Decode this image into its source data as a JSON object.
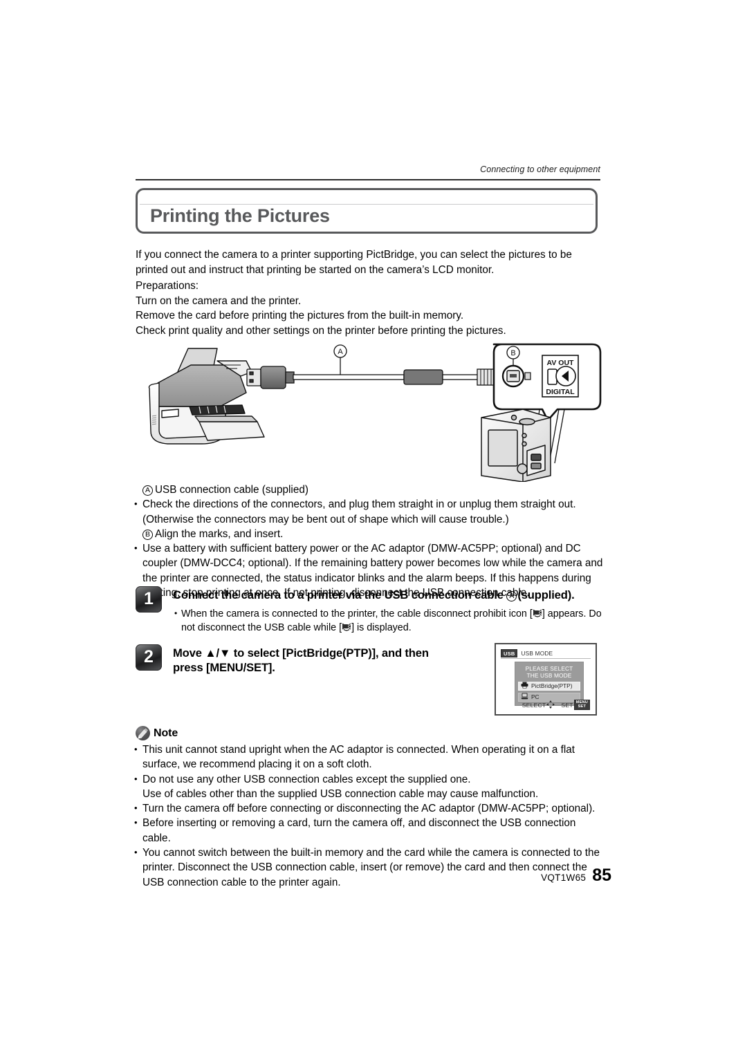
{
  "header": {
    "running_head": "Connecting to other equipment"
  },
  "title": {
    "text": "Printing the Pictures"
  },
  "intro": {
    "paragraph": "If you connect the camera to a printer supporting PictBridge, you can select the pictures to be printed out and instruct that printing be started on the camera’s LCD monitor."
  },
  "preparations": {
    "lines": [
      "Preparations:",
      "Turn on the camera and the printer.",
      "Remove the card before printing the pictures from the built-in memory.",
      "Check print quality and other settings on the printer before printing the pictures."
    ]
  },
  "diagram": {
    "label_a": "A",
    "label_b": "B",
    "camera_port_av": "AV OUT",
    "camera_port_digital": "DIGITAL"
  },
  "after_diagram": {
    "items": [
      {
        "marker": "A",
        "text": "USB connection cable (supplied)"
      },
      {
        "marker": "bullet",
        "text": "Check the directions of the connectors, and plug them straight in or unplug them straight out. (Otherwise the connectors may be bent out of shape which will cause trouble.)"
      },
      {
        "marker": "B",
        "text": "Align the marks, and insert."
      },
      {
        "marker": "bullet",
        "text": "Use a battery with sufficient battery power or the AC adaptor (DMW-AC5PP; optional) and DC coupler (DMW-DCC4; optional). If the remaining battery power becomes low while the camera and the printer are connected, the status indicator blinks and the alarm beeps. If this happens during printing, stop printing at once. If not printing, disconnect the USB connection cable."
      }
    ]
  },
  "steps": [
    {
      "number": "1",
      "title_before": "Connect the camera to a printer via the USB connection cable",
      "title_ref": "A",
      "title_after": "(supplied).",
      "sub_before": "When the camera is connected to the printer, the cable disconnect prohibit icon [",
      "sub_middle": "] appears. Do not disconnect the USB cable while [",
      "sub_after": "] is displayed."
    },
    {
      "number": "2",
      "title_line1": "Move ▲/▼ to select [PictBridge(PTP)], and then",
      "title_line2": "press [MENU/SET]."
    }
  ],
  "lcd": {
    "usb_tag": "USB",
    "topbar_label": "USB MODE",
    "panel_title_line1": "PLEASE SELECT",
    "panel_title_line2": "THE USB MODE",
    "options": [
      {
        "label": "PictBridge(PTP)",
        "selected": true,
        "icon": "printer-icon"
      },
      {
        "label": "PC",
        "selected": false,
        "icon": "pc-icon"
      }
    ],
    "footer_select": "SELECT",
    "footer_set": "SET",
    "set_key_line1": "MENU",
    "set_key_line2": "SET"
  },
  "note": {
    "label": "Note",
    "items": [
      "This unit cannot stand upright when the AC adaptor is connected. When operating it on a flat surface, we recommend placing it on a soft cloth.",
      "Do not use any other USB connection cables except the supplied one.",
      "Use of cables other than the supplied USB connection cable may cause malfunction.",
      "Turn the camera off before connecting or disconnecting the AC adaptor (DMW-AC5PP; optional).",
      "Before inserting or removing a card, turn the camera off, and disconnect the USB connection cable.",
      "You cannot switch between the built-in memory and the card while the camera is connected to the printer. Disconnect the USB connection cable, insert (or remove) the card and then connect the USB connection cable to the printer again."
    ],
    "item_markers": [
      "bullet",
      "bullet",
      "plain",
      "bullet",
      "bullet",
      "bullet"
    ]
  },
  "footer": {
    "code": "VQT1W65",
    "page": "85"
  },
  "colors": {
    "title_gray": "#58595b",
    "rule_dark": "#2b2b2b",
    "lcd_panel": "#9b9b9b"
  }
}
